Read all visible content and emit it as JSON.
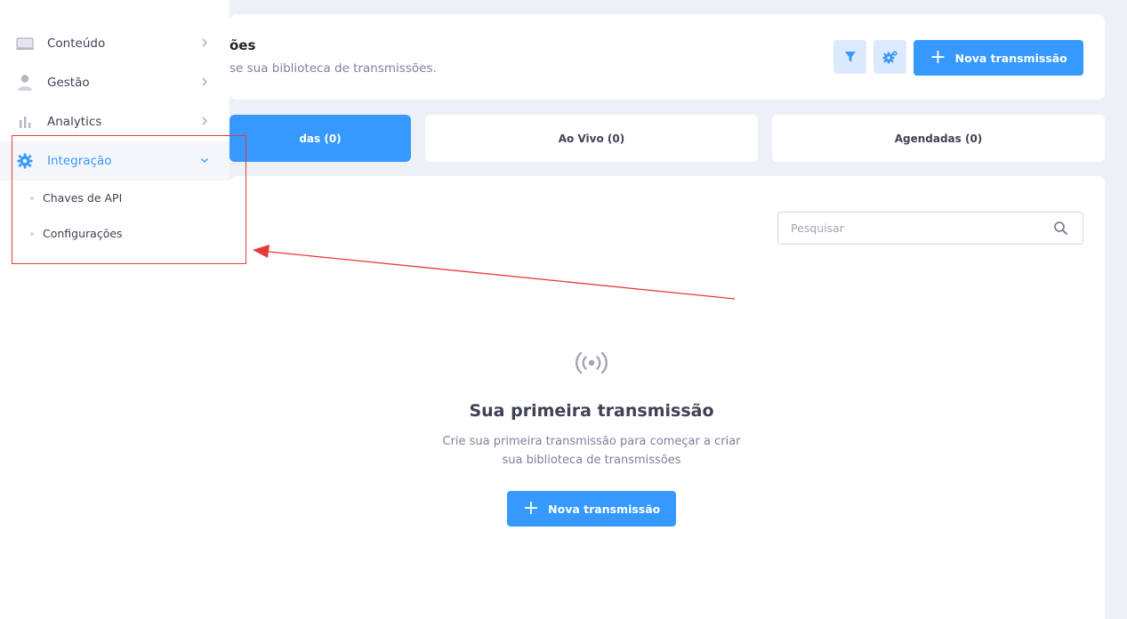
{
  "header": {
    "title": "ões",
    "subtitle": "se sua biblioteca de transmissões.",
    "filter_icon": "filter-icon",
    "settings_icon": "gears-icon",
    "new_button_label": "Nova transmissão"
  },
  "tabs": [
    {
      "label": "das (0)",
      "active": true
    },
    {
      "label": "Ao Vivo (0)",
      "active": false
    },
    {
      "label": "Agendadas (0)",
      "active": false
    }
  ],
  "search": {
    "placeholder": "Pesquisar",
    "icon": "search-icon"
  },
  "empty_state": {
    "icon": "broadcast-icon",
    "title": "Sua primeira transmissão",
    "description": "Crie sua primeira transmissão para começar a criar sua biblioteca de transmissões",
    "button_label": "Nova transmissão"
  },
  "sidebar": {
    "items": [
      {
        "label": "Conteúdo",
        "icon": "laptop-icon"
      },
      {
        "label": "Gestão",
        "icon": "user-icon"
      },
      {
        "label": "Analytics",
        "icon": "bar-chart-icon"
      },
      {
        "label": "Integração",
        "icon": "gear-icon",
        "active": true,
        "expanded": true
      }
    ],
    "subitems": [
      {
        "label": "Chaves de API"
      },
      {
        "label": "Configurações"
      }
    ]
  },
  "colors": {
    "primary": "#3699ff",
    "primary_light": "#dbeafe",
    "annotation_red": "#e53935",
    "background": "#eef0f7"
  }
}
